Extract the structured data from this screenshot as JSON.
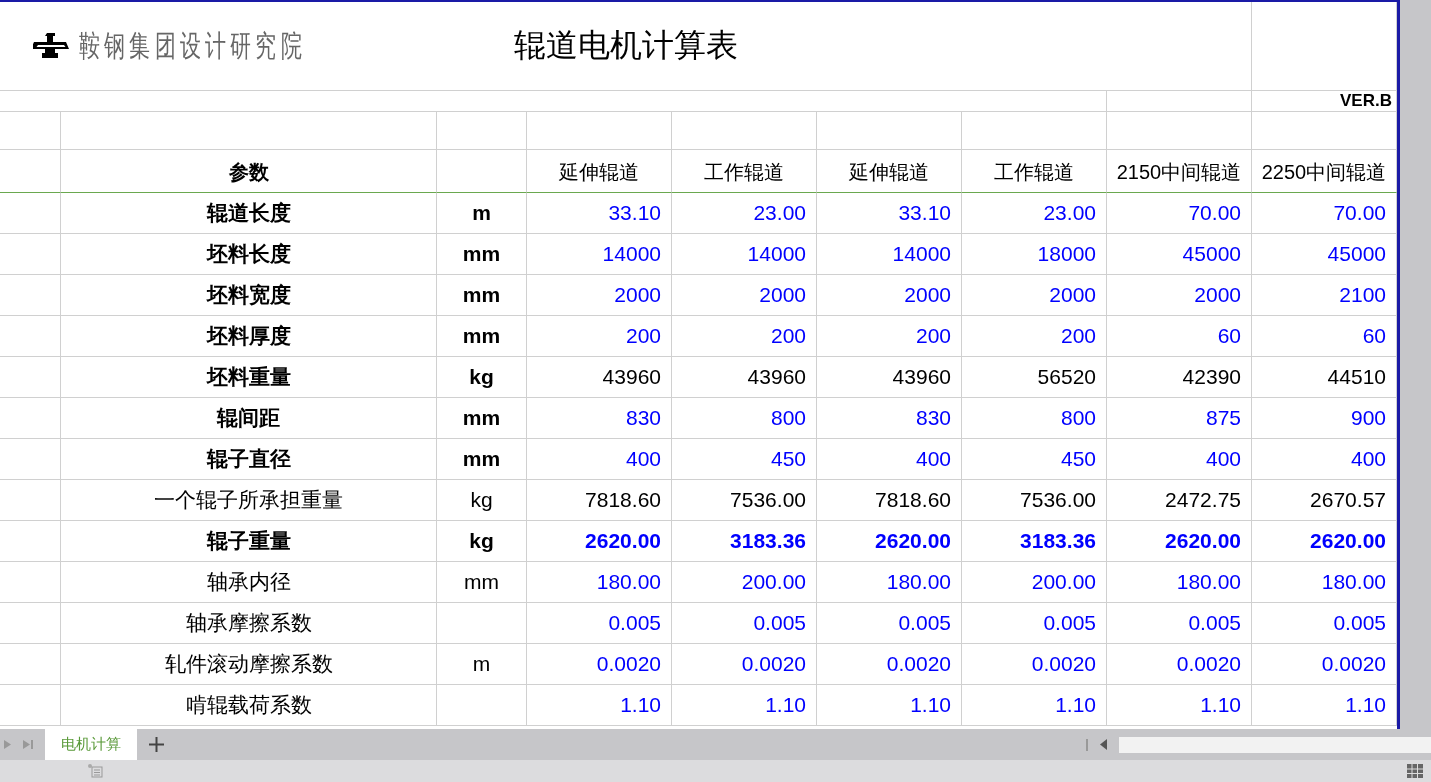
{
  "header": {
    "org": "鞍钢集团设计研究院",
    "title": "辊道电机计算表",
    "version": "VER.B"
  },
  "table": {
    "label_heading": "参数",
    "columns": [
      "延伸辊道",
      "工作辊道",
      "延伸辊道",
      "工作辊道",
      "2150中间辊道",
      "2250中间辊道"
    ],
    "rows": [
      {
        "kind": "key-input",
        "label": "辊道长度",
        "unit": "m",
        "values": [
          "33.10",
          "23.00",
          "33.10",
          "23.00",
          "70.00",
          "70.00"
        ]
      },
      {
        "kind": "key-input",
        "label": "坯料长度",
        "unit": "mm",
        "values": [
          "14000",
          "14000",
          "14000",
          "18000",
          "45000",
          "45000"
        ]
      },
      {
        "kind": "key-input",
        "label": "坯料宽度",
        "unit": "mm",
        "values": [
          "2000",
          "2000",
          "2000",
          "2000",
          "2000",
          "2100"
        ]
      },
      {
        "kind": "key-input",
        "label": "坯料厚度",
        "unit": "mm",
        "values": [
          "200",
          "200",
          "200",
          "200",
          "60",
          "60"
        ]
      },
      {
        "kind": "key-calc",
        "label": "坯料重量",
        "unit": "kg",
        "values": [
          "43960",
          "43960",
          "43960",
          "56520",
          "42390",
          "44510"
        ]
      },
      {
        "kind": "key-input",
        "label": "辊间距",
        "unit": "mm",
        "values": [
          "830",
          "800",
          "830",
          "800",
          "875",
          "900"
        ]
      },
      {
        "kind": "key-input",
        "label": "辊子直径",
        "unit": "mm",
        "values": [
          "400",
          "450",
          "400",
          "450",
          "400",
          "400"
        ]
      },
      {
        "kind": "calc",
        "label": "一个辊子所承担重量",
        "unit": "kg",
        "values": [
          "7818.60",
          "7536.00",
          "7818.60",
          "7536.00",
          "2472.75",
          "2670.57"
        ]
      },
      {
        "kind": "key-bold",
        "label": "辊子重量",
        "unit": "kg",
        "values": [
          "2620.00",
          "3183.36",
          "2620.00",
          "3183.36",
          "2620.00",
          "2620.00"
        ]
      },
      {
        "kind": "input",
        "label": "轴承内径",
        "unit": "mm",
        "values": [
          "180.00",
          "200.00",
          "180.00",
          "200.00",
          "180.00",
          "180.00"
        ]
      },
      {
        "kind": "input",
        "label": "轴承摩擦系数",
        "values": [
          "0.005",
          "0.005",
          "0.005",
          "0.005",
          "0.005",
          "0.005"
        ]
      },
      {
        "kind": "input",
        "label": "轧件滚动摩擦系数",
        "unit": "m",
        "values": [
          "0.0020",
          "0.0020",
          "0.0020",
          "0.0020",
          "0.0020",
          "0.0020"
        ]
      },
      {
        "kind": "input",
        "label": "啃辊载荷系数",
        "values": [
          "1.10",
          "1.10",
          "1.10",
          "1.10",
          "1.10",
          "1.10"
        ]
      }
    ]
  },
  "sheet_tabs": [
    {
      "label": "电机计算",
      "selected": true
    }
  ]
}
